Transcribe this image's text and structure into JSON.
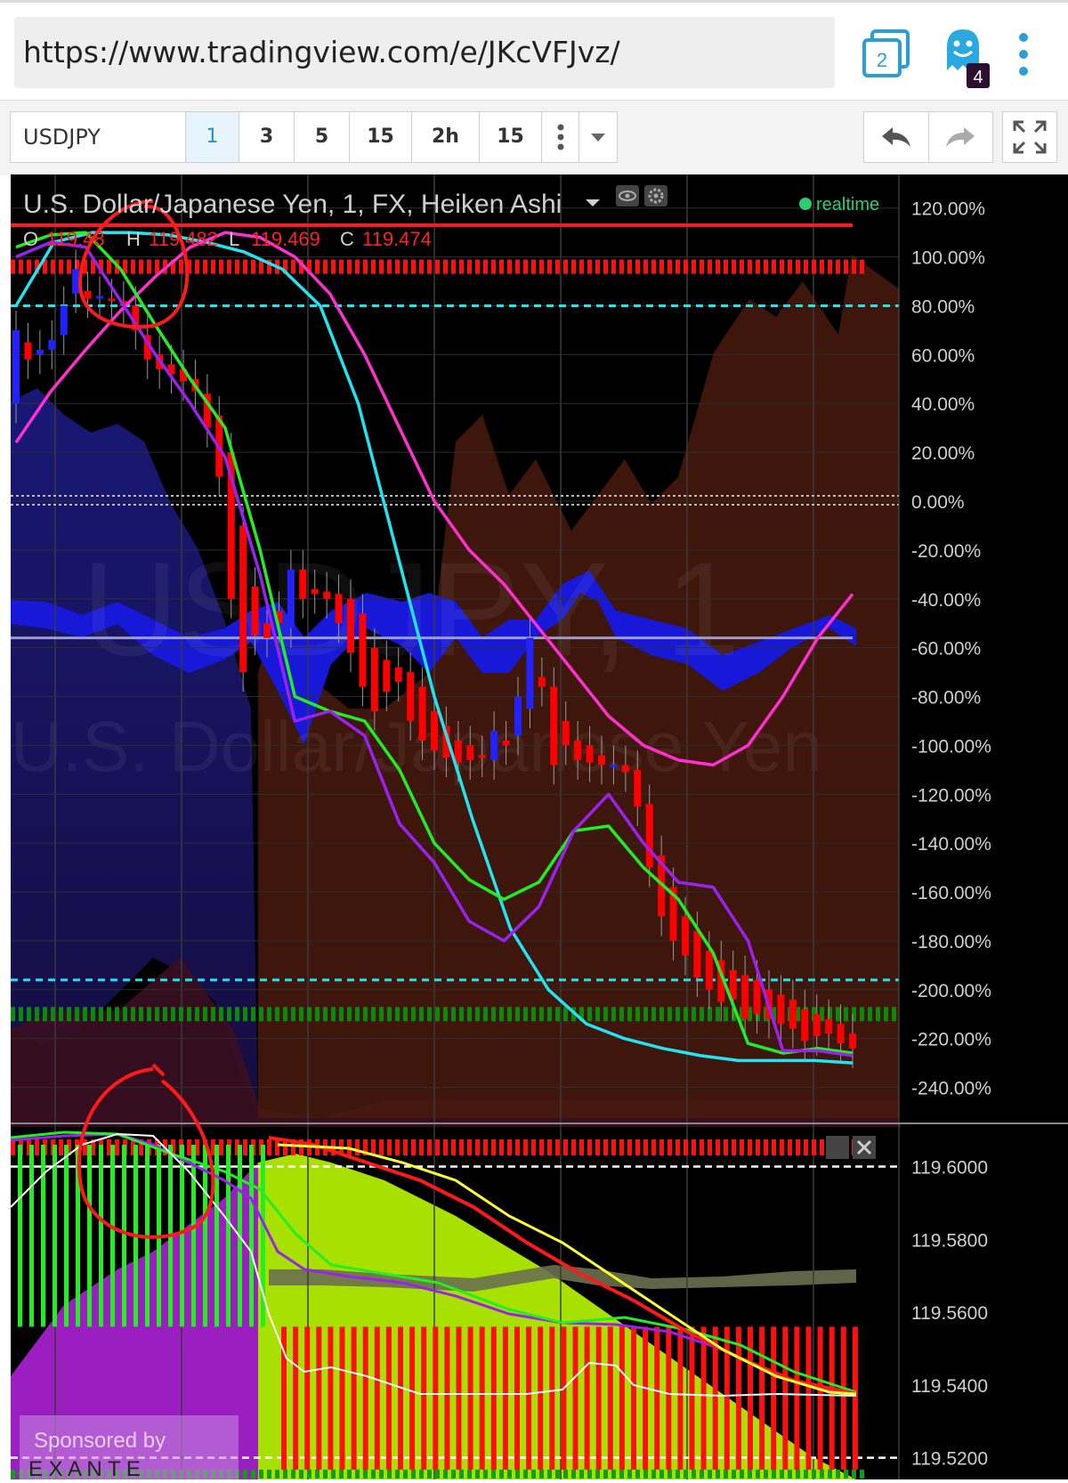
{
  "browser": {
    "url": "https://www.tradingview.com/e/JKcVFJvz/",
    "tabs_count": "2",
    "notification_count": "4"
  },
  "toolbar": {
    "symbol": "USDJPY",
    "intervals": [
      "1",
      "3",
      "5",
      "15",
      "2h",
      "15"
    ],
    "active_interval": "1"
  },
  "chart": {
    "title": "U.S. Dollar/Japanese Yen, 1, FX, Heiken Ashi",
    "status": "realtime",
    "ohlc": {
      "o_label": "O",
      "o_value": "119.48",
      "h_label": "H",
      "h_value": "119.482",
      "l_label": "L",
      "l_value": "119.469",
      "c_label": "C",
      "c_value": "119.474"
    },
    "watermark_symbol": "USDJPY, 1",
    "watermark_name": "U.S. Dollar/Japanese Yen",
    "sponsor_line1": "Sponsored by",
    "sponsor_line2": "E X A N T E"
  },
  "colors": {
    "bull": "#2222ff",
    "bear": "#ff0000",
    "cyan": "#22e4f0",
    "magenta": "#ff30d0",
    "green": "#22ee22",
    "purple": "#9a22ee",
    "orange": "#ffb020",
    "lime": "#a8e000",
    "yellow": "#ffff30",
    "status_green": "#2ecc71"
  },
  "chart_data": [
    {
      "type": "line",
      "title": "U.S. Dollar/Japanese Yen, 1, FX, Heiken Ashi",
      "y_axis_unit": "%",
      "yticks": [
        "120.00%",
        "100.00%",
        "80.00%",
        "60.00%",
        "40.00%",
        "20.00%",
        "0.00%",
        "-20.00%",
        "-40.00%",
        "-60.00%",
        "-80.00%",
        "-100.00%",
        "-120.00%",
        "-140.00%",
        "-160.00%",
        "-180.00%",
        "-200.00%",
        "-220.00%",
        "-240.00%"
      ],
      "ylim": [
        -250,
        125
      ],
      "hlines": [
        {
          "kind": "dotted-red",
          "y": 96
        },
        {
          "kind": "dashed-cyan",
          "y": 80
        },
        {
          "kind": "dotted-gray",
          "y": 0
        },
        {
          "kind": "solid-gray",
          "y": -56
        },
        {
          "kind": "dashed-cyan",
          "y": -196
        },
        {
          "kind": "dotted-green",
          "y": -210
        }
      ],
      "x": [
        0,
        1,
        2,
        3,
        4,
        5,
        6,
        7,
        8,
        9,
        10,
        11,
        12,
        13,
        14,
        15,
        16,
        17,
        18,
        19,
        20,
        21,
        22,
        23,
        24,
        25,
        26,
        27,
        28,
        29,
        30,
        31,
        32,
        33,
        34,
        35,
        36,
        37,
        38,
        39,
        40,
        41,
        42,
        43,
        44,
        45,
        46,
        47,
        48,
        49,
        50,
        51,
        52,
        53,
        54,
        55,
        56,
        57,
        58,
        59,
        60,
        61,
        62,
        63,
        64,
        65,
        66,
        67,
        68,
        69,
        70
      ],
      "candles": [
        {
          "o": 40,
          "c": 70
        },
        {
          "o": 65,
          "c": 58
        },
        {
          "o": 60,
          "c": 62
        },
        {
          "o": 62,
          "c": 66
        },
        {
          "o": 68,
          "c": 80
        },
        {
          "o": 85,
          "c": 95
        },
        {
          "o": 86,
          "c": 83
        },
        {
          "o": 84,
          "c": 84
        },
        {
          "o": 83,
          "c": 82
        },
        {
          "o": 82,
          "c": 80
        },
        {
          "o": 80,
          "c": 70
        },
        {
          "o": 68,
          "c": 58
        },
        {
          "o": 60,
          "c": 54
        },
        {
          "o": 56,
          "c": 52
        },
        {
          "o": 54,
          "c": 49
        },
        {
          "o": 50,
          "c": 45
        },
        {
          "o": 44,
          "c": 30
        },
        {
          "o": 35,
          "c": 10
        },
        {
          "o": 20,
          "c": -40
        },
        {
          "o": -10,
          "c": -70
        },
        {
          "o": -35,
          "c": -55
        },
        {
          "o": -50,
          "c": -56
        },
        {
          "o": -45,
          "c": -50
        },
        {
          "o": -52,
          "c": -28
        },
        {
          "o": -28,
          "c": -40
        },
        {
          "o": -36,
          "c": -38
        },
        {
          "o": -37,
          "c": -40
        },
        {
          "o": -38,
          "c": -50
        },
        {
          "o": -40,
          "c": -62
        },
        {
          "o": -46,
          "c": -76
        },
        {
          "o": -60,
          "c": -86
        },
        {
          "o": -65,
          "c": -78
        },
        {
          "o": -68,
          "c": -74
        },
        {
          "o": -70,
          "c": -90
        },
        {
          "o": -76,
          "c": -98
        },
        {
          "o": -86,
          "c": -102
        },
        {
          "o": -92,
          "c": -105
        },
        {
          "o": -98,
          "c": -107
        },
        {
          "o": -100,
          "c": -106
        },
        {
          "o": -104,
          "c": -105
        },
        {
          "o": -106,
          "c": -94
        },
        {
          "o": -98,
          "c": -100
        },
        {
          "o": -96,
          "c": -80
        },
        {
          "o": -85,
          "c": -56
        },
        {
          "o": -72,
          "c": -76
        },
        {
          "o": -76,
          "c": -108
        },
        {
          "o": -90,
          "c": -100
        },
        {
          "o": -98,
          "c": -106
        },
        {
          "o": -100,
          "c": -107
        },
        {
          "o": -104,
          "c": -108
        },
        {
          "o": -108,
          "c": -108
        },
        {
          "o": -108,
          "c": -111
        },
        {
          "o": -110,
          "c": -125
        },
        {
          "o": -124,
          "c": -150
        },
        {
          "o": -145,
          "c": -170
        },
        {
          "o": -158,
          "c": -180
        },
        {
          "o": -170,
          "c": -186
        },
        {
          "o": -176,
          "c": -195
        },
        {
          "o": -184,
          "c": -200
        },
        {
          "o": -188,
          "c": -205
        },
        {
          "o": -192,
          "c": -204
        },
        {
          "o": -194,
          "c": -212
        },
        {
          "o": -196,
          "c": -210
        },
        {
          "o": -200,
          "c": -212
        },
        {
          "o": -202,
          "c": -214
        },
        {
          "o": -204,
          "c": -216
        },
        {
          "o": -208,
          "c": -221
        },
        {
          "o": -210,
          "c": -219
        },
        {
          "o": -212,
          "c": -218
        },
        {
          "o": -214,
          "c": -222
        },
        {
          "o": -218,
          "c": -224
        }
      ],
      "series": [
        {
          "values": [
            80,
            106,
            110,
            110,
            109,
            106,
            102,
            95,
            80,
            40,
            -20,
            -80,
            -130,
            -175,
            -200,
            -214,
            -220,
            -224,
            -227,
            -229,
            -229,
            -229,
            -230
          ]
        },
        {
          "values": [
            24,
            45,
            62,
            78,
            92,
            104,
            110,
            108,
            100,
            85,
            60,
            30,
            0,
            -20,
            -34,
            -52,
            -70,
            -88,
            -100,
            -106,
            -108,
            -100,
            -80,
            -56,
            -38
          ]
        },
        {
          "values": [
            104,
            109,
            110,
            95,
            72,
            50,
            30,
            -20,
            -80,
            -86,
            -90,
            -110,
            -140,
            -155,
            -163,
            -156,
            -135,
            -133,
            -150,
            -163,
            -185,
            -222,
            -226,
            -224,
            -226
          ]
        },
        {
          "values": [
            100,
            106,
            104,
            82,
            60,
            40,
            18,
            -30,
            -90,
            -86,
            -96,
            -132,
            -148,
            -172,
            -180,
            -166,
            -135,
            -120,
            -140,
            -156,
            -158,
            -180,
            -225,
            -225,
            -227
          ]
        }
      ]
    },
    {
      "type": "area",
      "yticks": [
        "119.6000",
        "119.5800",
        "119.5600",
        "119.5400",
        "119.5200"
      ],
      "ylim": [
        119.516,
        119.606
      ],
      "hlines": [
        119.6,
        119.52
      ],
      "histogram": {
        "green": [
          119.556,
          119.556,
          119.556,
          119.556,
          119.556,
          119.556,
          119.556,
          119.556,
          119.556,
          119.556,
          119.556,
          119.556,
          119.556,
          119.556,
          119.556,
          119.556,
          119.556,
          119.556,
          119.556,
          119.556,
          119.556,
          119.556
        ],
        "red": [
          119.556,
          119.556,
          119.556,
          119.556,
          119.556,
          119.556,
          119.556,
          119.556,
          119.556,
          119.556,
          119.556,
          119.556,
          119.556,
          119.556,
          119.556,
          119.556,
          119.556,
          119.556,
          119.556,
          119.556,
          119.556,
          119.556,
          119.556,
          119.556,
          119.556,
          119.556,
          119.556,
          119.556,
          119.556,
          119.556,
          119.556,
          119.556,
          119.556,
          119.556,
          119.556,
          119.556,
          119.556,
          119.556,
          119.556,
          119.556,
          119.556,
          119.556,
          119.556,
          119.556,
          119.556,
          119.556,
          119.556,
          119.556,
          119.556,
          119.556
        ]
      }
    }
  ]
}
